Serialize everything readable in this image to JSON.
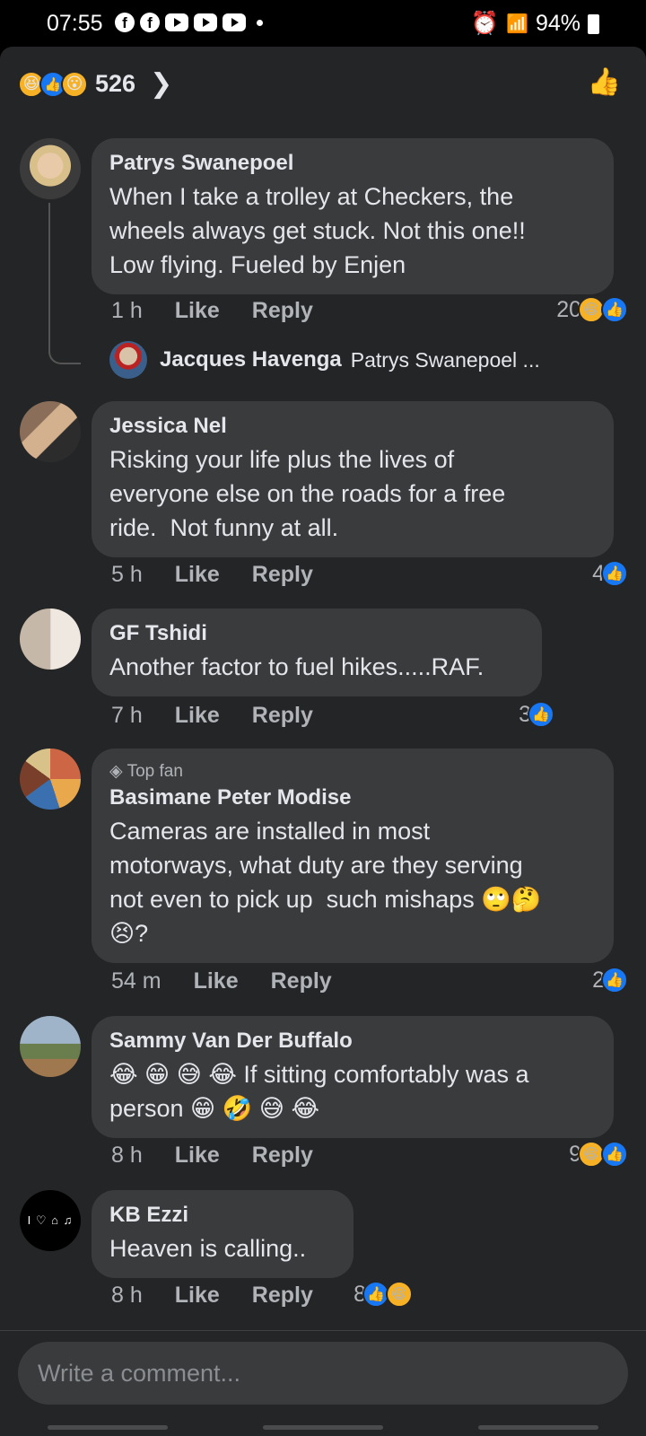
{
  "status": {
    "time": "07:55",
    "battery": "94%",
    "icons": [
      "facebook-icon",
      "facebook-icon",
      "youtube-icon",
      "youtube-icon",
      "youtube-icon",
      "alarm-icon",
      "wifi-icon",
      "signal-icon",
      "battery-icon"
    ]
  },
  "reactions": {
    "count": "526",
    "emojis": [
      "😆",
      "👍",
      "😮"
    ]
  },
  "comments": [
    {
      "name": "Patrys Swanepoel",
      "text": "When I take a trolley at Checkers, the\nwheels always get stuck. Not this one!!\nLow flying. Fueled by Enjen",
      "time": "1 h",
      "like": "Like",
      "reply": "Reply",
      "react_count": "20",
      "react_emojis": [
        "😆",
        "👍"
      ]
    },
    {
      "name": "Jessica Nel",
      "text": "Risking your life plus the lives of\neveryone else on the roads for a free\nride.  Not funny at all.",
      "time": "5 h",
      "like": "Like",
      "reply": "Reply",
      "react_count": "4",
      "react_emojis": [
        "👍"
      ]
    },
    {
      "name": "GF Tshidi",
      "text": "Another factor to fuel hikes.....RAF.",
      "time": "7 h",
      "like": "Like",
      "reply": "Reply",
      "react_count": "3",
      "react_emojis": [
        "👍"
      ]
    },
    {
      "badge": "Top fan",
      "name": "Basimane Peter Modise",
      "text": "Cameras are installed in most\nmotorways, what duty are they serving\nnot even to pick up  such mishaps 🙄🤔\n😣?",
      "time": "54 m",
      "like": "Like",
      "reply": "Reply",
      "react_count": "2",
      "react_emojis": [
        "👍"
      ]
    },
    {
      "name": "Sammy Van Der Buffalo",
      "text": "😂 😁 😅 😂 If sitting comfortably was a\nperson 😁 🤣 😅 😂",
      "time": "8 h",
      "like": "Like",
      "reply": "Reply",
      "react_count": "9",
      "react_emojis": [
        "😆",
        "👍"
      ]
    },
    {
      "name": "KB Ezzi",
      "text": "Heaven is calling..",
      "time": "8 h",
      "like": "Like",
      "reply": "Reply",
      "react_count": "8",
      "react_emojis": [
        "👍",
        "😆"
      ],
      "avatar_text": "I ♡ ⌂ ♫"
    }
  ],
  "reply_preview": {
    "name": "Jacques Havenga",
    "text": "Patrys Swanepoel ..."
  },
  "composer": {
    "placeholder": "Write a comment..."
  }
}
